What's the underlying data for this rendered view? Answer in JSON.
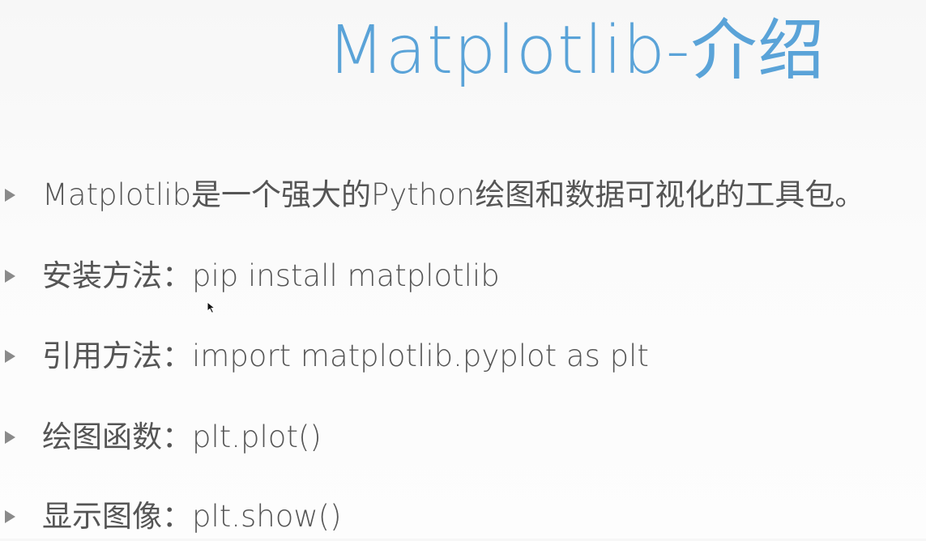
{
  "slide": {
    "title": "Matplotlib-介绍",
    "bullets": [
      "Matplotlib是一个强大的Python绘图和数据可视化的工具包。",
      "安装方法：pip install matplotlib",
      "引用方法：import matplotlib.pyplot as plt",
      "绘图函数：plt.plot()",
      "显示图像：plt.show()"
    ]
  },
  "colors": {
    "title": "#5aa3d8",
    "text": "#555555",
    "bullet_marker": "#8a8a8a"
  },
  "icons": {
    "bullet": "triangle-bullet-icon",
    "cursor": "mouse-cursor-icon"
  }
}
